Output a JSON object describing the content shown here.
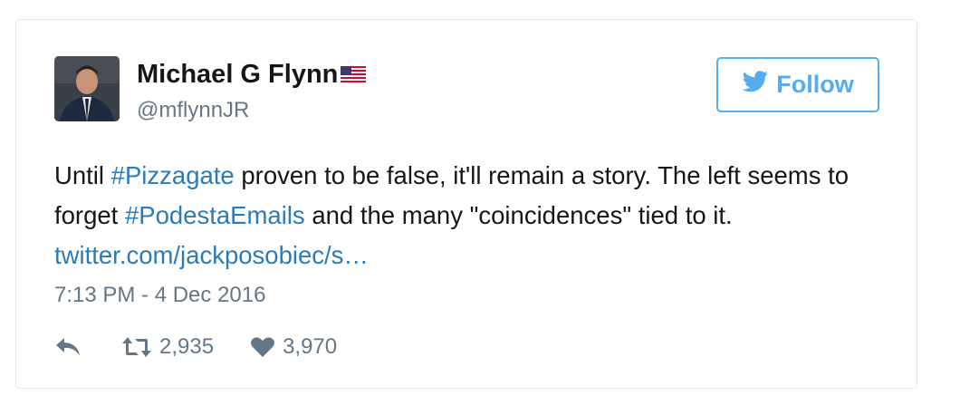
{
  "tweet": {
    "author_name": "Michael G Flynn",
    "author_flag_icon": "us-flag-icon",
    "handle": "@mflynnJR",
    "follow_label": "Follow",
    "text": {
      "part1": "Until ",
      "hashtag1": "#Pizzagate",
      "part2": " proven to be false, it'll remain a story. The left seems to forget ",
      "hashtag2": "#PodestaEmails",
      "part3": " and the many \"coincidences\" tied to it. ",
      "link": "twitter.com/jackposobiec/s…"
    },
    "timestamp": "7:13 PM - 4 Dec 2016",
    "retweet_count": "2,935",
    "like_count": "3,970"
  },
  "colors": {
    "twitter_blue": "#55acee",
    "link_blue": "#2b7bb9",
    "muted_gray": "#657786",
    "text_dark": "#14171a",
    "border": "#e1e8ed"
  },
  "icons": {
    "follow": "twitter-bird-icon",
    "reply": "reply-icon",
    "retweet": "retweet-icon",
    "like": "heart-icon"
  }
}
